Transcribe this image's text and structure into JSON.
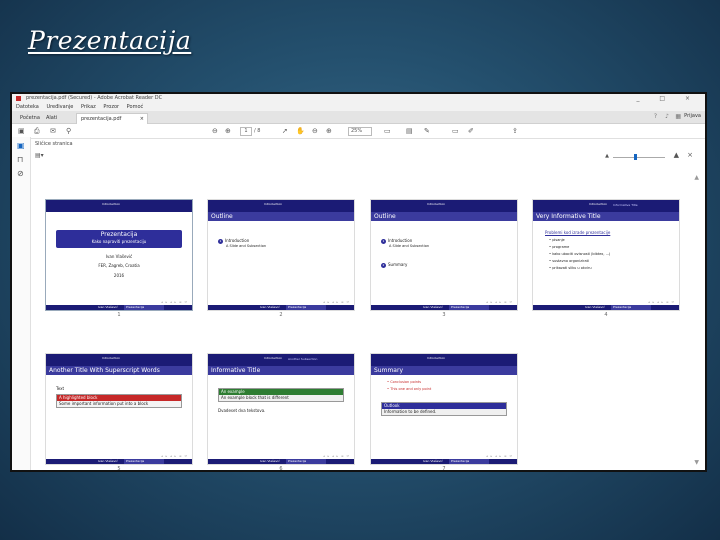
{
  "slide": {
    "title": "Prezentacija"
  },
  "window": {
    "title": "prezentacija.pdf (Secured) - Adobe Acrobat Reader DC",
    "controls": "_ □ ×",
    "menu": [
      "Datoteka",
      "Uređivanje",
      "Prikaz",
      "Prozor",
      "Pomoć"
    ],
    "tabs": {
      "home": "Početna",
      "tools": "Alati",
      "doc": "prezentacija.pdf",
      "login": "Prijava"
    },
    "toolbar": {
      "page": "1",
      "pages": "/ 8",
      "zoom": "25%"
    },
    "panel": {
      "title": "Sličice stranica"
    }
  },
  "thumbnails": [
    {
      "num": "1",
      "header": "Introduction",
      "title_main": "Prezentacija",
      "title_sub": "Kako napraviti prezentaciju",
      "author": "Ivan Vlašević",
      "institution": "FER, Zagreb, Croatia",
      "year": "2016",
      "foot_a": "Ivan Vlašević",
      "foot_b": "Prezentacija"
    },
    {
      "num": "2",
      "header": "Introduction",
      "frame_title": "Outline",
      "items": [
        {
          "n": "1",
          "text": "Introduction",
          "sub": "A Slide and Subsection"
        }
      ],
      "foot_a": "Ivan Vlašević",
      "foot_b": "Prezentacija"
    },
    {
      "num": "3",
      "header": "Introduction",
      "frame_title": "Outline",
      "items": [
        {
          "n": "1",
          "text": "Introduction",
          "sub": "A Slide and Subsection"
        },
        {
          "n": "2",
          "text": "Summary",
          "sub": ""
        }
      ],
      "foot_a": "Ivan Vlašević",
      "foot_b": "Prezentacija"
    },
    {
      "num": "4",
      "header": "Introduction",
      "header2": "Informative Title",
      "frame_title": "Very Informative Title",
      "heading": "Problemi kod izrade prezentacije",
      "list": [
        "pisanje",
        "programe",
        "kako ubaciti ovisnosti (bibtex, ...)",
        "sustavno organizirati",
        "prikazati sliku u okviru"
      ],
      "foot_a": "Ivan Vlašević",
      "foot_b": "Prezentacija"
    },
    {
      "num": "5",
      "header": "Introduction",
      "frame_title": "Another Title With Superscript Words",
      "lead": "Text",
      "block_h": "A highlighted block",
      "block_b": "Some important information put into a block",
      "foot_a": "Ivan Vlašević",
      "foot_b": "Prezentacija"
    },
    {
      "num": "6",
      "header": "Introduction",
      "header2": "Another Subsection",
      "frame_title": "Informative Title",
      "block_h": "An example",
      "block_b": "An example block that is different",
      "tail": "Dvadeset dva tekstova.",
      "foot_a": "Ivan Vlašević",
      "foot_b": "Prezentacija"
    },
    {
      "num": "7",
      "header": "Introduction",
      "frame_title": "Summary",
      "list": [
        "Conclusion points",
        "This one and only point"
      ],
      "block_h": "Outlook",
      "block_b": "Information to be defined.",
      "foot_a": "Ivan Vlašević",
      "foot_b": "Prezentacija"
    }
  ],
  "colors": {
    "header": "#1b1b75",
    "frame": "#3b3b9e",
    "alert": "#c62828",
    "example": "#2e7d32"
  }
}
